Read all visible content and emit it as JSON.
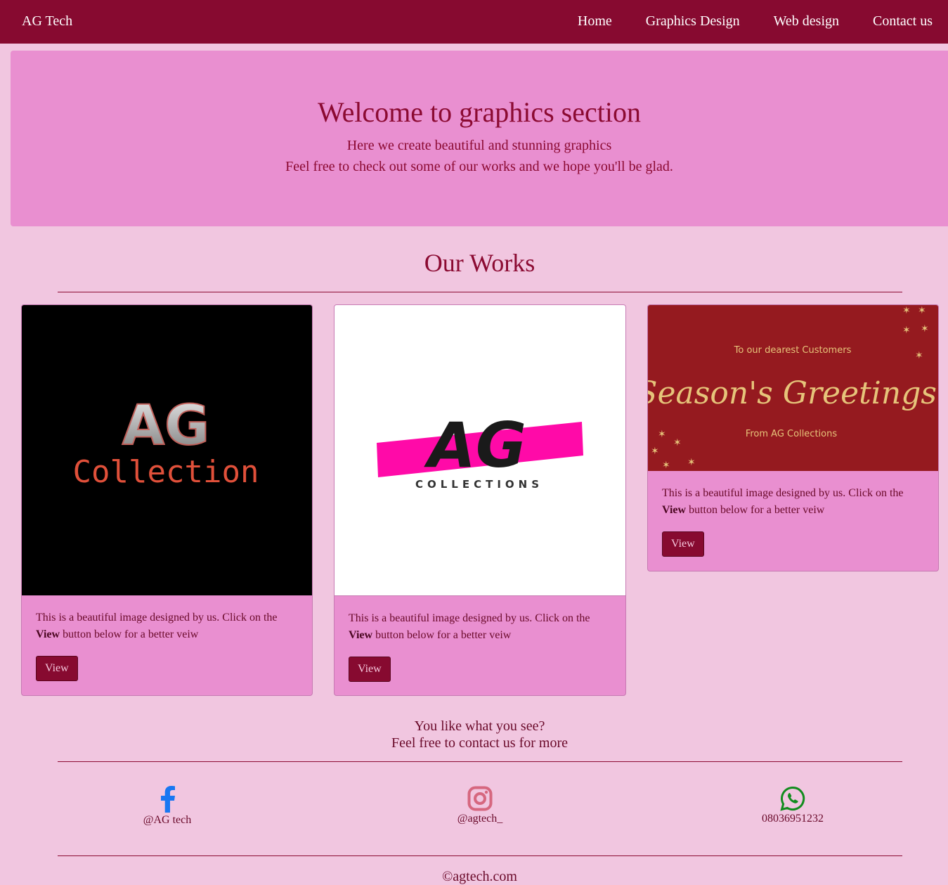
{
  "nav": {
    "brand": "AG Tech",
    "links": [
      "Home",
      "Graphics Design",
      "Web design",
      "Contact us"
    ]
  },
  "hero": {
    "title": "Welcome to graphics section",
    "line1": "Here we create beautiful and stunning graphics",
    "line2": "Feel free to check out some of our works and we hope you'll be glad."
  },
  "works": {
    "title": "Our Works",
    "cards": [
      {
        "image_text_top": "AG",
        "image_text_bottom": "Collection",
        "text_before": "This is a beautiful image designed by us. Click on the ",
        "text_bold": "View",
        "text_after": " button below for a better veiw",
        "button": "View"
      },
      {
        "image_text_top": "AG",
        "image_text_bottom": "COLLECTIONS",
        "text_before": "This is a beautiful image designed by us. Click on the ",
        "text_bold": "View",
        "text_after": " button below for a better veiw",
        "button": "View"
      },
      {
        "image_text_top": "To our dearest Customers",
        "image_text_middle": "Season's Greetings!",
        "image_text_bottom": "From AG Collections",
        "text_before": "This is a beautiful image designed by us. Click on the ",
        "text_bold": "View",
        "text_after": " button below for a better veiw",
        "button": "View"
      }
    ]
  },
  "cta": {
    "line1": "You like what you see?",
    "line2": "Feel free to contact us for more"
  },
  "social": [
    {
      "icon": "facebook-icon",
      "label": "@AG tech",
      "color": "#1877f2"
    },
    {
      "icon": "instagram-icon",
      "label": "@agtech_",
      "color": "#d6677f"
    },
    {
      "icon": "whatsapp-icon",
      "label": "08036951232",
      "color": "#128c1e"
    }
  ],
  "footer": {
    "copyright": "©agtech.com"
  },
  "colors": {
    "primary": "#870a30",
    "page_bg": "#f1c6e0",
    "card_bg": "#e98fd0",
    "pink_accent": "#ff0aa8",
    "greeting_bg": "#951a1f",
    "gold": "#e6c47a"
  }
}
